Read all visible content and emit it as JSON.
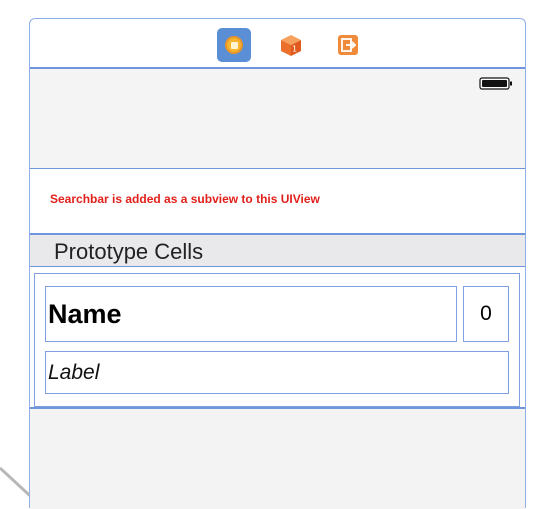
{
  "dock": {
    "icons": [
      "view-controller-icon",
      "first-responder-icon",
      "exit-icon"
    ],
    "accent_color": "#5a8fd6"
  },
  "status_bar": {
    "icon": "battery-icon"
  },
  "header_view": {
    "note": "Searchbar is added as a subview to this UIView",
    "note_color": "#e1201b"
  },
  "table": {
    "section_title": "Prototype Cells",
    "cell": {
      "name_label": "Name",
      "count_label": "0",
      "sub_label": "Label"
    }
  }
}
